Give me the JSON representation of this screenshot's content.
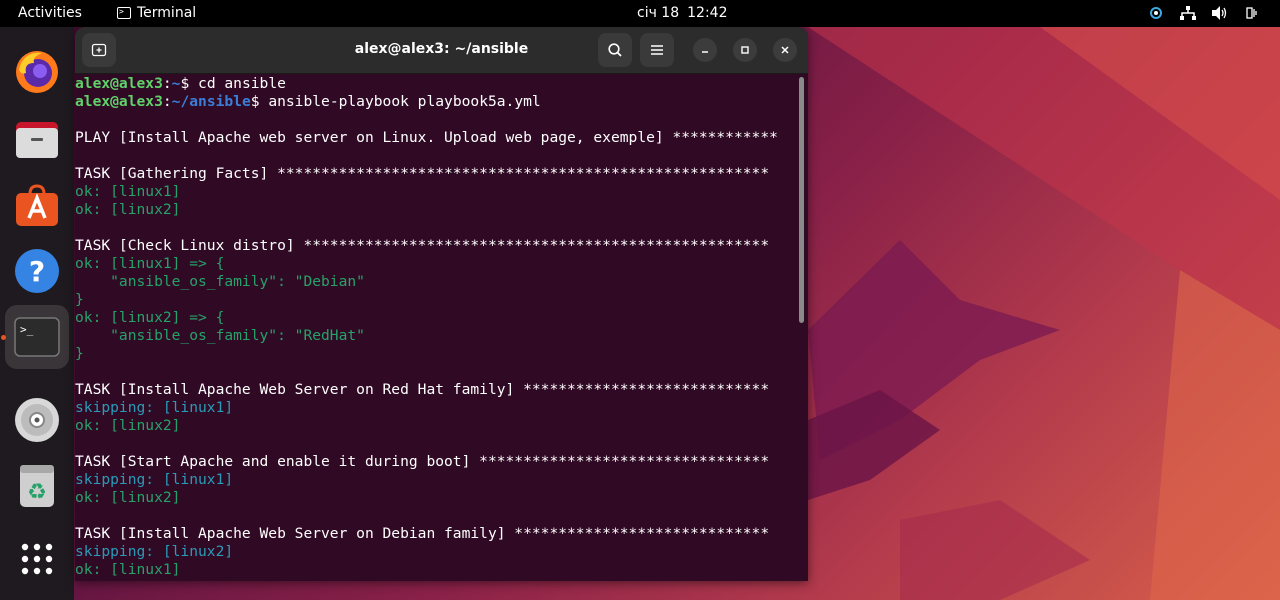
{
  "topbar": {
    "activities": "Activities",
    "app_name": "Terminal",
    "date": "січ 18",
    "time": "12:42"
  },
  "dock": {
    "items": [
      {
        "name": "Firefox",
        "icon": "firefox-icon"
      },
      {
        "name": "Files",
        "icon": "files-icon"
      },
      {
        "name": "Ubuntu Software",
        "icon": "software-store-icon"
      },
      {
        "name": "Help",
        "icon": "help-icon"
      },
      {
        "name": "Terminal",
        "icon": "terminal-icon",
        "running": true
      },
      {
        "name": "Disc",
        "icon": "disc-icon"
      },
      {
        "name": "Trash",
        "icon": "trash-icon"
      },
      {
        "name": "Show Applications",
        "icon": "app-grid-icon"
      }
    ]
  },
  "window": {
    "title": "alex@alex3: ~/ansible"
  },
  "terminal": {
    "lines": [
      {
        "type": "prompt",
        "user": "alex@alex3",
        "path": "~",
        "cmd": "$ cd ansible"
      },
      {
        "type": "prompt",
        "user": "alex@alex3",
        "path": "~/ansible",
        "cmd": "$ ansible-playbook playbook5a.yml"
      },
      {
        "type": "blank",
        "text": ""
      },
      {
        "type": "plain",
        "text": "PLAY [Install Apache web server on Linux. Upload web page, exemple] ************"
      },
      {
        "type": "blank",
        "text": ""
      },
      {
        "type": "plain",
        "text": "TASK [Gathering Facts] ********************************************************"
      },
      {
        "type": "ok",
        "text": "ok: [linux1]"
      },
      {
        "type": "ok",
        "text": "ok: [linux2]"
      },
      {
        "type": "blank",
        "text": ""
      },
      {
        "type": "plain",
        "text": "TASK [Check Linux distro] *****************************************************"
      },
      {
        "type": "ok",
        "text": "ok: [linux1] => {"
      },
      {
        "type": "ok",
        "text": "    \"ansible_os_family\": \"Debian\""
      },
      {
        "type": "ok",
        "text": "}"
      },
      {
        "type": "ok",
        "text": "ok: [linux2] => {"
      },
      {
        "type": "ok",
        "text": "    \"ansible_os_family\": \"RedHat\""
      },
      {
        "type": "ok",
        "text": "}"
      },
      {
        "type": "blank",
        "text": ""
      },
      {
        "type": "plain",
        "text": "TASK [Install Apache Web Server on Red Hat family] ****************************"
      },
      {
        "type": "skip",
        "text": "skipping: [linux1]"
      },
      {
        "type": "ok",
        "text": "ok: [linux2]"
      },
      {
        "type": "blank",
        "text": ""
      },
      {
        "type": "plain",
        "text": "TASK [Start Apache and enable it during boot] *********************************"
      },
      {
        "type": "skip",
        "text": "skipping: [linux1]"
      },
      {
        "type": "ok",
        "text": "ok: [linux2]"
      },
      {
        "type": "blank",
        "text": ""
      },
      {
        "type": "plain",
        "text": "TASK [Install Apache Web Server on Debian family] *****************************"
      },
      {
        "type": "skip",
        "text": "skipping: [linux2]"
      },
      {
        "type": "ok",
        "text": "ok: [linux1]"
      }
    ]
  },
  "colors": {
    "terminal_bg": "#300a24",
    "prompt_user": "#5fd26a",
    "prompt_path": "#3b7ed8",
    "ok": "#26a269",
    "skipping": "#2a9bb8",
    "accent": "#e95420"
  }
}
